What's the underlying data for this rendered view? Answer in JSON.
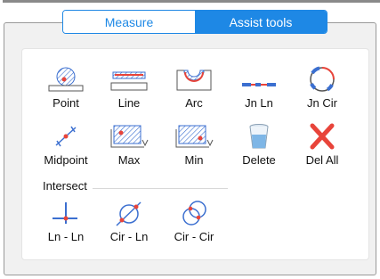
{
  "tabs": [
    {
      "label": "Measure",
      "active": false
    },
    {
      "label": "Assist tools",
      "active": true
    }
  ],
  "tools": [
    {
      "label": "Point",
      "icon": "point-icon"
    },
    {
      "label": "Line",
      "icon": "line-icon"
    },
    {
      "label": "Arc",
      "icon": "arc-icon"
    },
    {
      "label": "Jn Ln",
      "icon": "join-line-icon"
    },
    {
      "label": "Jn Cir",
      "icon": "join-circle-icon"
    },
    {
      "label": "Midpoint",
      "icon": "midpoint-icon"
    },
    {
      "label": "Max",
      "icon": "max-icon"
    },
    {
      "label": "Min",
      "icon": "min-icon"
    },
    {
      "label": "Delete",
      "icon": "trash-icon"
    },
    {
      "label": "Del All",
      "icon": "delete-all-icon"
    }
  ],
  "intersect": {
    "title": "Intersect",
    "tools": [
      {
        "label": "Ln - Ln",
        "icon": "line-line-intersect-icon"
      },
      {
        "label": "Cir - Ln",
        "icon": "circle-line-intersect-icon"
      },
      {
        "label": "Cir - Cir",
        "icon": "circle-circle-intersect-icon"
      }
    ]
  },
  "colors": {
    "accent": "#1e88e5",
    "marker": "#e8443a",
    "hatch": "#3b6fd0"
  }
}
